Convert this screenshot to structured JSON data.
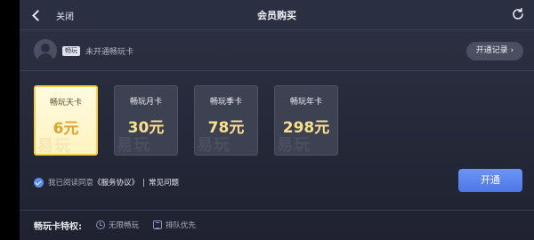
{
  "header": {
    "back_label": "关闭",
    "title": "会员购买",
    "refresh_icon": "refresh-icon"
  },
  "user": {
    "badge": "畅玩",
    "status": "未开通畅玩卡",
    "history_label": "开通记录 ›"
  },
  "cards": [
    {
      "name": "畅玩天卡",
      "price": "6元",
      "watermark": "易玩",
      "selected": true
    },
    {
      "name": "畅玩月卡",
      "price": "30元",
      "watermark": "易玩",
      "selected": false
    },
    {
      "name": "畅玩季卡",
      "price": "78元",
      "watermark": "易玩",
      "selected": false
    },
    {
      "name": "畅玩年卡",
      "price": "298元",
      "watermark": "易玩",
      "selected": false
    }
  ],
  "agreement": {
    "checked": true,
    "prefix": "我已阅读同意",
    "link": "《服务协议》",
    "faq": "常见问题"
  },
  "open_button": "开通",
  "perks": {
    "title": "畅玩卡特权:",
    "items": [
      {
        "label": "无限畅玩",
        "icon": "clock-icon"
      },
      {
        "label": "排队优先",
        "icon": "queue-icon"
      }
    ]
  },
  "colors": {
    "accent_blue": "#5b8cf0",
    "gold_price": "#fde08a",
    "selected_border": "#f6cf4a"
  }
}
